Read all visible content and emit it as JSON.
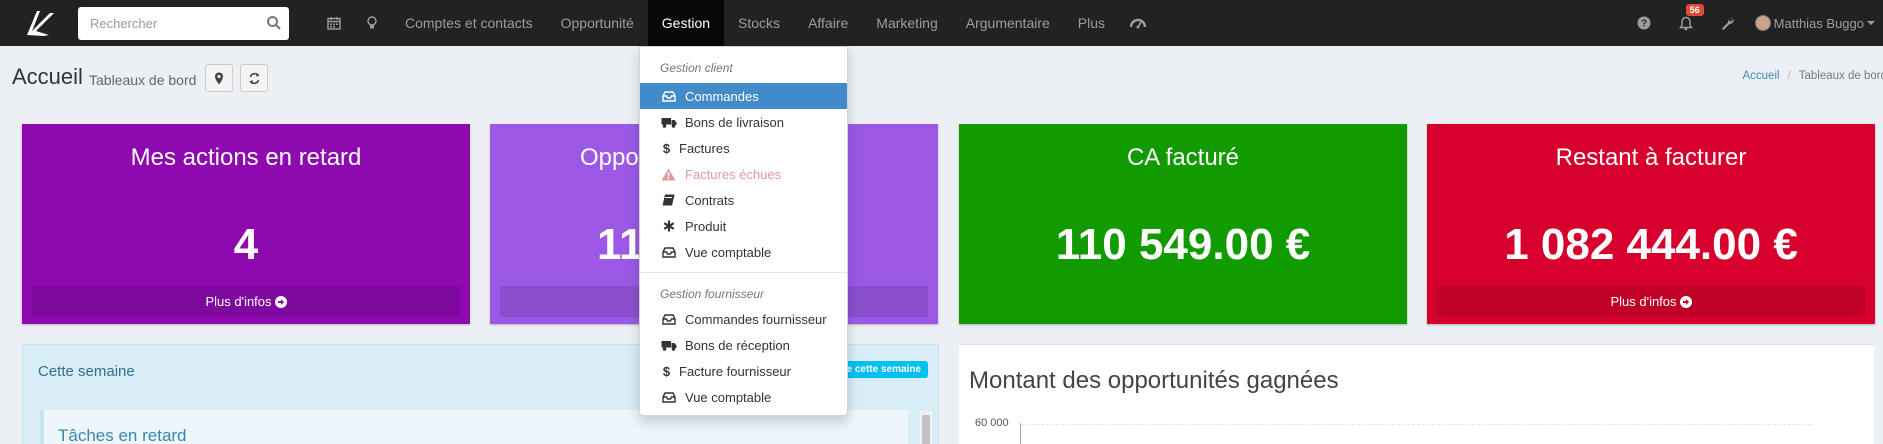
{
  "navbar": {
    "search_placeholder": "Rechercher",
    "menu": [
      {
        "label": "Comptes et contacts"
      },
      {
        "label": "Opportunité"
      },
      {
        "label": "Gestion"
      },
      {
        "label": "Stocks"
      },
      {
        "label": "Affaire"
      },
      {
        "label": "Marketing"
      },
      {
        "label": "Argumentaire"
      },
      {
        "label": "Plus"
      }
    ],
    "active_menu": "Gestion",
    "notification_count": "56",
    "user_name": "Matthias Buggo"
  },
  "header": {
    "title": "Accueil",
    "subtitle": "Tableaux de bord",
    "breadcrumb": [
      "Accueil",
      "Tableaux de bord"
    ]
  },
  "tiles": [
    {
      "title": "Mes actions en retard",
      "value": "4",
      "footer": "Plus d'infos",
      "color": "#8e09b0"
    },
    {
      "title": "Oppo",
      "value": "11",
      "footer": "",
      "color": "#9b59e6"
    },
    {
      "title": "CA facturé",
      "value": "110 549.00 €",
      "footer": "",
      "color": "#119b00"
    },
    {
      "title": "Restant à facturer",
      "value": "1 082 444.00 €",
      "footer": "Plus d'infos",
      "color": "#d7002d"
    }
  ],
  "week_box": {
    "title": "Cette semaine",
    "label": "e cette semaine",
    "inner_title": "Tâches en retard"
  },
  "chart": {
    "title": "Montant des opportunités gagnées",
    "tick": "60 000"
  },
  "dropdown": {
    "client_header": "Gestion client",
    "client_items": [
      {
        "label": "Commandes",
        "icon": "inbox-icon"
      },
      {
        "label": "Bons de livraison",
        "icon": "truck-icon"
      },
      {
        "label": "Factures",
        "icon": "dollar-icon"
      },
      {
        "label": "Factures échues",
        "icon": "warning-icon"
      },
      {
        "label": "Contrats",
        "icon": "book-icon"
      },
      {
        "label": "Produit",
        "icon": "asterisk-icon"
      },
      {
        "label": "Vue comptable",
        "icon": "inbox-icon"
      }
    ],
    "supplier_header": "Gestion fournisseur",
    "supplier_items": [
      {
        "label": "Commandes fournisseur",
        "icon": "inbox-icon"
      },
      {
        "label": "Bons de réception",
        "icon": "truck-icon"
      },
      {
        "label": "Facture fournisseur",
        "icon": "dollar-icon"
      },
      {
        "label": "Vue comptable",
        "icon": "inbox-icon"
      }
    ]
  },
  "colors": {
    "navbar": "#222222",
    "dropdown_active": "#428bca",
    "link": "#3c8dbc",
    "week_box_bg": "#d9edf7",
    "label_bg": "#00c0ef",
    "badge": "#dd4b39"
  }
}
